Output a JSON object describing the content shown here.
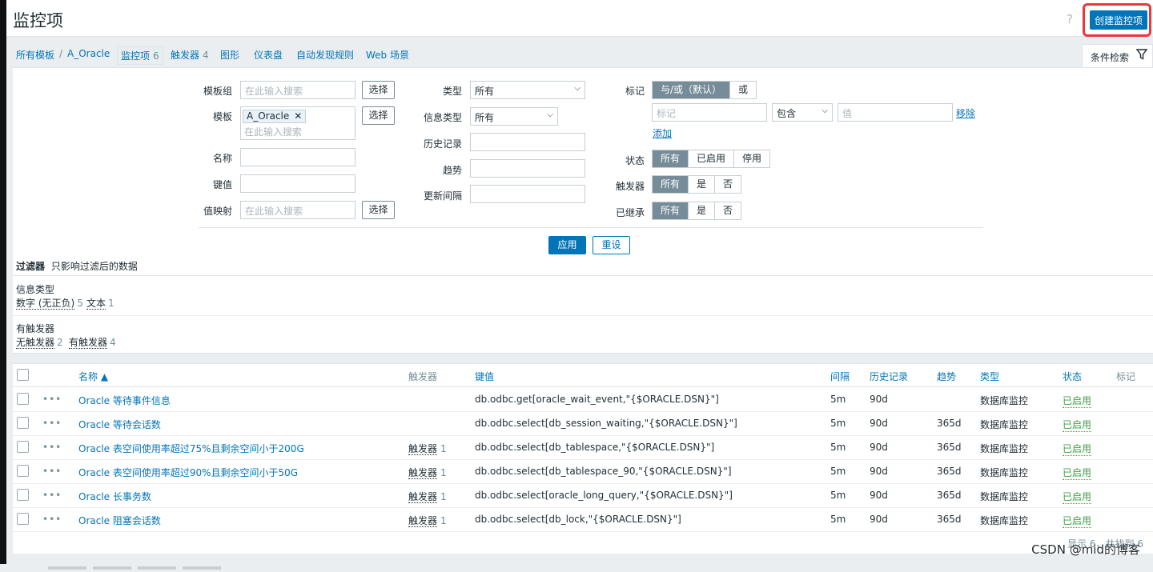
{
  "header": {
    "title": "监控项",
    "help": "?",
    "create_button": "创建监控项"
  },
  "breadcrumb": {
    "all_templates": "所有模板",
    "separator": "/",
    "template": "A_Oracle",
    "tabs": [
      {
        "label": "监控项",
        "count": "6"
      },
      {
        "label": "触发器",
        "count": "4"
      },
      {
        "label": "图形",
        "count": ""
      },
      {
        "label": "仪表盘",
        "count": ""
      },
      {
        "label": "自动发现规则",
        "count": ""
      },
      {
        "label": "Web 场景",
        "count": ""
      }
    ]
  },
  "filter_tab": {
    "label": "条件检索",
    "icon": "filter-icon"
  },
  "filter": {
    "template_group": {
      "label": "模板组",
      "placeholder": "在此输入搜索",
      "button": "选择"
    },
    "template": {
      "label": "模板",
      "tag": "A_Oracle",
      "tag_remove": "✕",
      "placeholder": "在此输入搜索",
      "button": "选择"
    },
    "name": {
      "label": "名称",
      "value": ""
    },
    "key": {
      "label": "键值",
      "value": ""
    },
    "value_map": {
      "label": "值映射",
      "placeholder": "在此输入搜索",
      "button": "选择"
    },
    "type": {
      "label": "类型",
      "value": "所有"
    },
    "info_type": {
      "label": "信息类型",
      "value": "所有"
    },
    "history": {
      "label": "历史记录",
      "value": ""
    },
    "trend": {
      "label": "趋势",
      "value": ""
    },
    "interval": {
      "label": "更新间隔",
      "value": ""
    },
    "tags": {
      "label": "标记",
      "and_or": "与/或（默认）",
      "or": "或",
      "tag_placeholder": "标记",
      "operator": "包含",
      "value_placeholder": "值",
      "remove": "移除",
      "add": "添加"
    },
    "status": {
      "label": "状态",
      "options": [
        "所有",
        "已启用",
        "停用"
      ]
    },
    "triggers": {
      "label": "触发器",
      "options": [
        "所有",
        "是",
        "否"
      ]
    },
    "inherited": {
      "label": "已继承",
      "options": [
        "所有",
        "是",
        "否"
      ]
    },
    "apply": "应用",
    "reset": "重设"
  },
  "subfilter": {
    "title": "过滤器",
    "desc": "只影响过滤后的数据"
  },
  "facets": {
    "info_type": {
      "title": "信息类型",
      "items": [
        {
          "label": "数字 (无正负)",
          "count": "5"
        },
        {
          "label": "文本",
          "count": "1"
        }
      ]
    },
    "has_triggers": {
      "title": "有触发器",
      "items": [
        {
          "label": "无触发器",
          "count": "2"
        },
        {
          "label": "有触发器",
          "count": "4"
        }
      ]
    }
  },
  "table": {
    "headers": {
      "name": "名称 ▲",
      "triggers": "触发器",
      "key": "键值",
      "interval": "间隔",
      "history": "历史记录",
      "trends": "趋势",
      "type": "类型",
      "status": "状态",
      "tags": "标记"
    },
    "rows": [
      {
        "name": "Oracle 等待事件信息",
        "triggers": "",
        "trig_count": "",
        "key": "db.odbc.get[oracle_wait_event,\"{$ORACLE.DSN}\"]",
        "interval": "5m",
        "history": "90d",
        "trends": "",
        "type": "数据库监控",
        "status": "已启用"
      },
      {
        "name": "Oracle 等待会话数",
        "triggers": "",
        "trig_count": "",
        "key": "db.odbc.select[db_session_waiting,\"{$ORACLE.DSN}\"]",
        "interval": "5m",
        "history": "90d",
        "trends": "365d",
        "type": "数据库监控",
        "status": "已启用"
      },
      {
        "name": "Oracle 表空间使用率超过75%且剩余空间小于200G",
        "triggers": "触发器",
        "trig_count": "1",
        "key": "db.odbc.select[db_tablespace,\"{$ORACLE.DSN}\"]",
        "interval": "5m",
        "history": "90d",
        "trends": "365d",
        "type": "数据库监控",
        "status": "已启用"
      },
      {
        "name": "Oracle 表空间使用率超过90%且剩余空间小于50G",
        "triggers": "触发器",
        "trig_count": "1",
        "key": "db.odbc.select[db_tablespace_90,\"{$ORACLE.DSN}\"]",
        "interval": "5m",
        "history": "90d",
        "trends": "365d",
        "type": "数据库监控",
        "status": "已启用"
      },
      {
        "name": "Oracle 长事务数",
        "triggers": "触发器",
        "trig_count": "1",
        "key": "db.odbc.select[oracle_long_query,\"{$ORACLE.DSN}\"]",
        "interval": "5m",
        "history": "90d",
        "trends": "365d",
        "type": "数据库监控",
        "status": "已启用"
      },
      {
        "name": "Oracle 阻塞会话数",
        "triggers": "触发器",
        "trig_count": "1",
        "key": "db.odbc.select[db_lock,\"{$ORACLE.DSN}\"]",
        "interval": "5m",
        "history": "90d",
        "trends": "365d",
        "type": "数据库监控",
        "status": "已启用"
      }
    ],
    "footer": "显示 6，共找到 6"
  },
  "watermark": "CSDN @mid的博客",
  "colors": {
    "primary": "#0275b8",
    "enabled": "#429e47",
    "highlight": "#e9373c"
  }
}
